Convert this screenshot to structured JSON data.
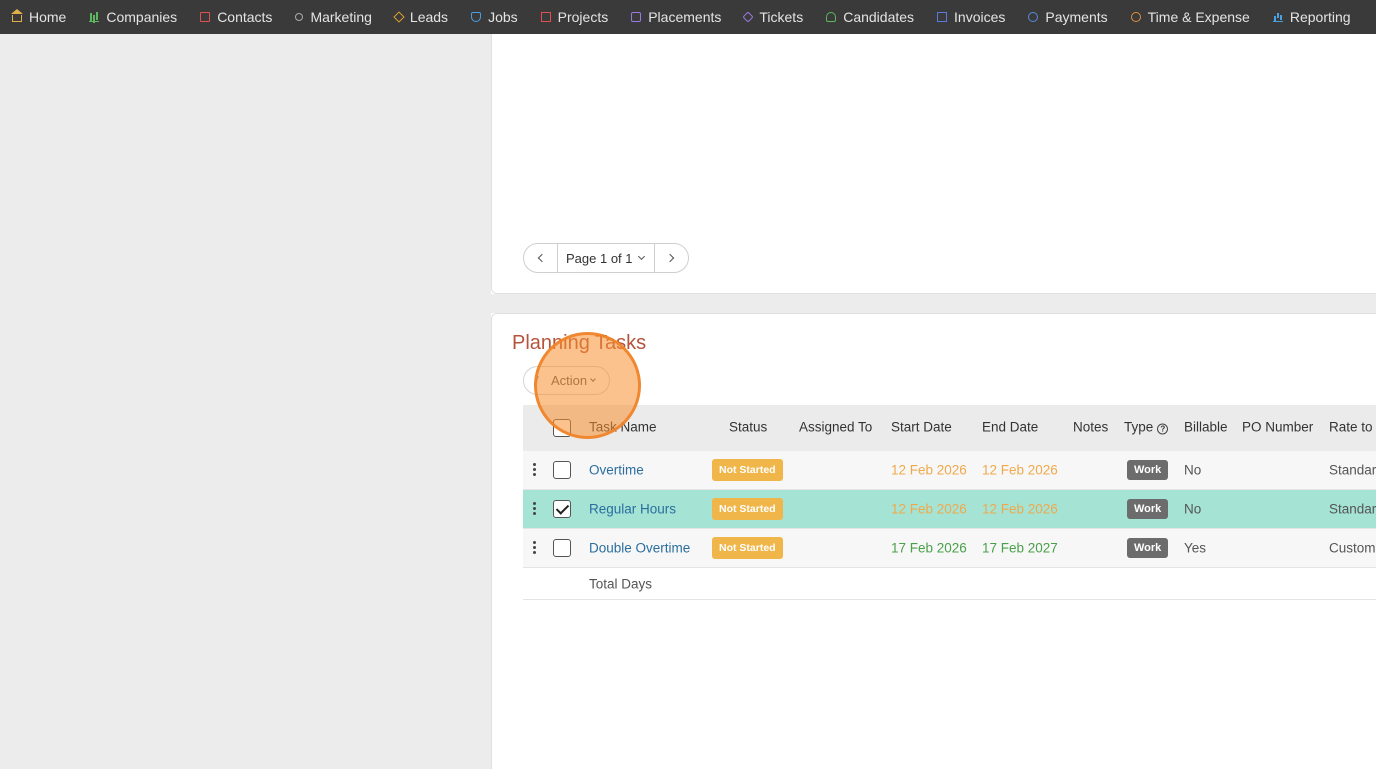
{
  "nav": {
    "items": [
      {
        "label": "Home",
        "icon": "home-icon"
      },
      {
        "label": "Companies",
        "icon": "companies-icon"
      },
      {
        "label": "Contacts",
        "icon": "contacts-icon"
      },
      {
        "label": "Marketing",
        "icon": "marketing-icon"
      },
      {
        "label": "Leads",
        "icon": "leads-icon"
      },
      {
        "label": "Jobs",
        "icon": "jobs-icon"
      },
      {
        "label": "Projects",
        "icon": "projects-icon"
      },
      {
        "label": "Placements",
        "icon": "placements-icon"
      },
      {
        "label": "Tickets",
        "icon": "tickets-icon"
      },
      {
        "label": "Candidates",
        "icon": "candidates-icon"
      },
      {
        "label": "Invoices",
        "icon": "invoices-icon"
      },
      {
        "label": "Payments",
        "icon": "payments-icon"
      },
      {
        "label": "Time & Expense",
        "icon": "time-icon"
      },
      {
        "label": "Reporting",
        "icon": "reporting-icon"
      }
    ]
  },
  "pager": {
    "label": "Page 1 of 1"
  },
  "planning": {
    "title": "Planning Tasks",
    "action_label": "Action",
    "columns": {
      "task_name": "Task Name",
      "status": "Status",
      "assigned_to": "Assigned To",
      "start_date": "Start Date",
      "end_date": "End Date",
      "notes": "Notes",
      "type": "Type",
      "billable": "Billable",
      "po_number": "PO Number",
      "rate_to": "Rate to"
    },
    "rows": [
      {
        "task": "Overtime",
        "status": "Not Started",
        "start": "12 Feb 2026",
        "end": "12 Feb 2026",
        "type": "Work",
        "billable": "No",
        "rate": "Standar",
        "checked": false
      },
      {
        "task": "Regular Hours",
        "status": "Not Started",
        "start": "12 Feb 2026",
        "end": "12 Feb 2026",
        "type": "Work",
        "billable": "No",
        "rate": "Standar",
        "checked": true
      },
      {
        "task": "Double Overtime",
        "status": "Not Started",
        "start": "17 Feb 2026",
        "end": "17 Feb 2027",
        "type": "Work",
        "billable": "Yes",
        "rate": "Custom",
        "checked": false
      }
    ],
    "total_label": "Total Days"
  },
  "colors": {
    "nav_bg": "#3a3a3a",
    "title": "#b5543a",
    "link": "#2a6e9e",
    "selected_row": "#a5e3d5",
    "status_badge": "#f0b64a",
    "click_highlight": "#f89032"
  }
}
